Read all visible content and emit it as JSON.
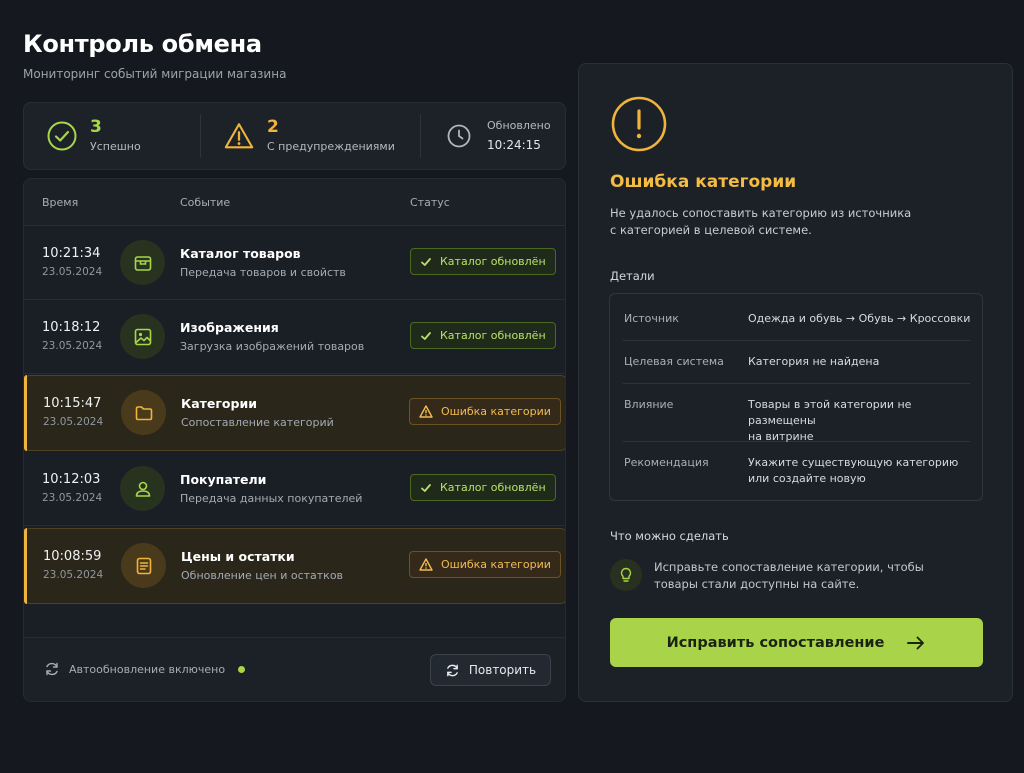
{
  "header": {
    "title": "Контроль обмена",
    "subtitle": "Мониторинг событий миграции магазина"
  },
  "stats": {
    "success": {
      "count": "3",
      "label": "Успешно",
      "icon": "check-circle-icon",
      "color": "#a8d64a"
    },
    "warnings": {
      "count": "2",
      "label": "С предупреждениями",
      "icon": "warning-triangle-icon",
      "color": "#f0b43c"
    },
    "updated": {
      "label": "Обновлено",
      "time": "10:24:15",
      "icon": "clock-icon"
    }
  },
  "table": {
    "columns": [
      "Время",
      "Событие",
      "Статус"
    ],
    "rows": [
      {
        "time": "10:21:34",
        "date": "23.05.2024",
        "icon": "box-icon",
        "title": "Каталог товаров",
        "subtitle": "Передача товаров и свойств",
        "status": "Каталог обновлён",
        "state": "ok"
      },
      {
        "time": "10:18:12",
        "date": "23.05.2024",
        "icon": "image-icon",
        "title": "Изображения",
        "subtitle": "Загрузка изображений товаров",
        "status": "Каталог обновлён",
        "state": "ok"
      },
      {
        "time": "10:15:47",
        "date": "23.05.2024",
        "icon": "folder-icon",
        "title": "Категории",
        "subtitle": "Сопоставление категорий",
        "status": "Ошибка категории",
        "state": "warning"
      },
      {
        "time": "10:12:03",
        "date": "23.05.2024",
        "icon": "user-icon",
        "title": "Покупатели",
        "subtitle": "Передача данных покупателей",
        "status": "Каталог обновлён",
        "state": "ok"
      },
      {
        "time": "10:08:59",
        "date": "23.05.2024",
        "icon": "document-icon",
        "title": "Цены и остатки",
        "subtitle": "Обновление цен и остатков",
        "status": "Ошибка категории",
        "state": "warning"
      }
    ]
  },
  "footer": {
    "autorefresh_label": "Автообновление включено",
    "retry_label": "Повторить"
  },
  "detail": {
    "icon": "exclamation-circle-icon",
    "title": "Ошибка категории",
    "text_line1": "Не удалось сопоставить категорию из источника",
    "text_line2": "с категорией в целевой системе.",
    "details_label": "Детали",
    "rows": [
      {
        "key": "Источник",
        "value_line1": "Одежда и обувь → Обувь → Кроссовки",
        "value_line2": ""
      },
      {
        "key": "Целевая система",
        "value_line1": "Категория не найдена",
        "value_line2": ""
      },
      {
        "key": "Влияние",
        "value_line1": "Товары в этой категории не размещены",
        "value_line2": "на витрине"
      },
      {
        "key": "Рекомендация",
        "value_line1": "Укажите существующую категорию",
        "value_line2": "или создайте новую"
      }
    ],
    "actions_label": "Что можно сделать",
    "tip_line1": "Исправьте сопоставление категории, чтобы",
    "tip_line2": "товары стали доступны на сайте.",
    "fix_button": "Исправить сопоставление"
  },
  "colors": {
    "accent_green": "#a9d44a",
    "warning_orange": "#f0b43c",
    "background": "#15191f"
  }
}
